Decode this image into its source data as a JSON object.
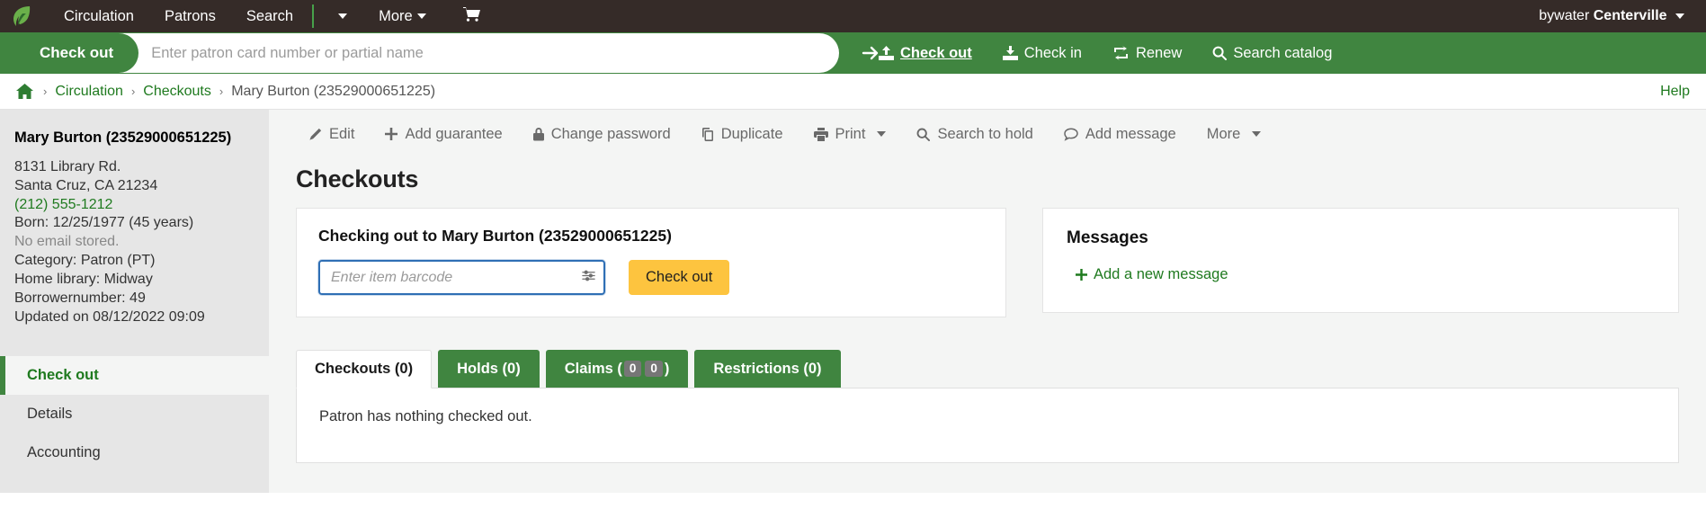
{
  "topnav": {
    "logo_icon": "koha-leaf-logo",
    "items": [
      {
        "label": "Circulation",
        "name": "topnav-circulation"
      },
      {
        "label": "Patrons",
        "name": "topnav-patrons"
      },
      {
        "label": "Search",
        "name": "topnav-search"
      }
    ],
    "more_label": "More",
    "cart_icon": "cart-icon",
    "user_prefix": "bywater",
    "user_library": "Centerville"
  },
  "searchbar": {
    "tab_label": "Check out",
    "placeholder": "Enter patron card number or partial name",
    "input_value": "",
    "submit_icon": "arrow-right-icon",
    "links": [
      {
        "label": "Check out",
        "icon": "check-out-icon",
        "active": true
      },
      {
        "label": "Check in",
        "icon": "check-in-icon",
        "active": false
      },
      {
        "label": "Renew",
        "icon": "renew-icon",
        "active": false
      },
      {
        "label": "Search catalog",
        "icon": "search-icon",
        "active": false
      }
    ]
  },
  "breadcrumb": {
    "home_icon": "home-icon",
    "items": [
      {
        "label": "Circulation",
        "link": true
      },
      {
        "label": "Checkouts",
        "link": true
      },
      {
        "label": "Mary Burton (23529000651225)",
        "link": false
      }
    ],
    "separator": "›",
    "help_label": "Help"
  },
  "sidebar": {
    "patron_name": "Mary Burton (23529000651225)",
    "details": [
      {
        "text": "8131 Library Rd.",
        "style": "normal"
      },
      {
        "text": "Santa Cruz, CA 21234",
        "style": "normal"
      },
      {
        "text": "(212) 555-1212",
        "style": "phone"
      },
      {
        "text": "Born: 12/25/1977 (45 years)",
        "style": "normal"
      },
      {
        "text": "No email stored.",
        "style": "muted"
      },
      {
        "text": "Category: Patron (PT)",
        "style": "normal"
      },
      {
        "text": "Home library: Midway",
        "style": "normal"
      },
      {
        "text": "Borrowernumber: 49",
        "style": "normal"
      },
      {
        "text": "Updated on 08/12/2022 09:09",
        "style": "normal"
      }
    ],
    "nav": [
      {
        "label": "Check out",
        "active": true
      },
      {
        "label": "Details",
        "active": false
      },
      {
        "label": "Accounting",
        "active": false
      }
    ]
  },
  "toolbar": {
    "buttons": [
      {
        "label": "Edit",
        "icon": "pencil-icon",
        "caret": false
      },
      {
        "label": "Add guarantee",
        "icon": "plus-icon",
        "caret": false
      },
      {
        "label": "Change password",
        "icon": "lock-icon",
        "caret": false
      },
      {
        "label": "Duplicate",
        "icon": "copy-icon",
        "caret": false
      },
      {
        "label": "Print",
        "icon": "printer-icon",
        "caret": true
      },
      {
        "label": "Search to hold",
        "icon": "search-icon",
        "caret": false
      },
      {
        "label": "Add message",
        "icon": "comment-icon",
        "caret": false
      },
      {
        "label": "More",
        "icon": "",
        "caret": true
      }
    ]
  },
  "main": {
    "page_title": "Checkouts",
    "checkout_card": {
      "title": "Checking out to Mary Burton (23529000651225)",
      "barcode_placeholder": "Enter item barcode",
      "barcode_value": "",
      "settings_icon": "sliders-icon",
      "submit_label": "Check out"
    },
    "messages_card": {
      "title": "Messages",
      "add_label": "Add a new message",
      "add_icon": "plus-icon"
    },
    "tabs": [
      {
        "label": "Checkouts (0)",
        "active": true,
        "badges": []
      },
      {
        "label": "Holds (0)",
        "active": false,
        "badges": []
      },
      {
        "label_pre": "Claims (",
        "label_post": ")",
        "active": false,
        "badges": [
          "0",
          "0"
        ]
      },
      {
        "label": "Restrictions (0)",
        "active": false,
        "badges": []
      }
    ],
    "tab_panel_text": "Patron has nothing checked out."
  },
  "colors": {
    "topbar_bg": "#352b28",
    "green": "#408540",
    "link_green": "#1f7a1f",
    "yellow_button": "#fdc43f",
    "sidebar_bg": "#e6e6e6",
    "page_bg": "#f4f5f4",
    "focus_blue": "#2f6fb5"
  }
}
